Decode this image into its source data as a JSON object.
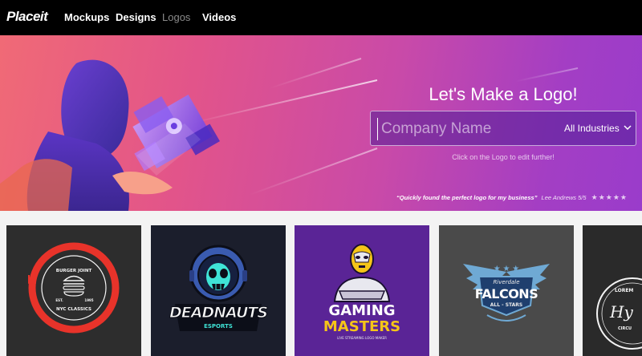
{
  "nav": {
    "logo": "Placeit",
    "links": [
      "Mockups",
      "Designs",
      "Logos",
      "Videos"
    ],
    "active": "Logos"
  },
  "hero": {
    "title": "Let's Make a Logo!",
    "search_placeholder": "Company Name",
    "industry": "All Industries",
    "hint": "Click on the Logo to edit further!",
    "testimonial_quote": "“Quickly found the perfect logo for my business”",
    "testimonial_author": "Lee Andrews 5/5",
    "stars": "★★★★★"
  },
  "cards": [
    {
      "bg": "#2d2d2d",
      "line1": "BURGER JOINT",
      "line2": "NYC CLASSICS",
      "est": "EST.",
      "year": "1995"
    },
    {
      "bg": "#1b1e2c",
      "word": "DEADNAUTS",
      "sub": "ESPORTS"
    },
    {
      "bg": "#5a2496",
      "word1": "GAMING",
      "word2": "MASTERS",
      "sub": "LIVE STREAMING LOGO MAKER"
    },
    {
      "bg": "#4a4a4a",
      "top": "Riverdale",
      "word": "FALCONS",
      "sub": "ALL - STARS"
    },
    {
      "bg": "#2a2a2a",
      "word": "LOREM",
      "sub": "CIRCU",
      "script": "Hy"
    }
  ],
  "colors": {
    "nav_bg": "#000000",
    "hero_start": "#f06a76",
    "hero_end": "#9a3ccb",
    "accent_red": "#e8332a",
    "gold": "#f5c518"
  },
  "icons": [
    "chevron-down-icon",
    "star-icon",
    "burger-icon",
    "fork-icon",
    "knife-icon",
    "astronaut-skull-icon",
    "wrestler-mask-icon",
    "falcon-wings-icon",
    "star-badge-icon"
  ]
}
